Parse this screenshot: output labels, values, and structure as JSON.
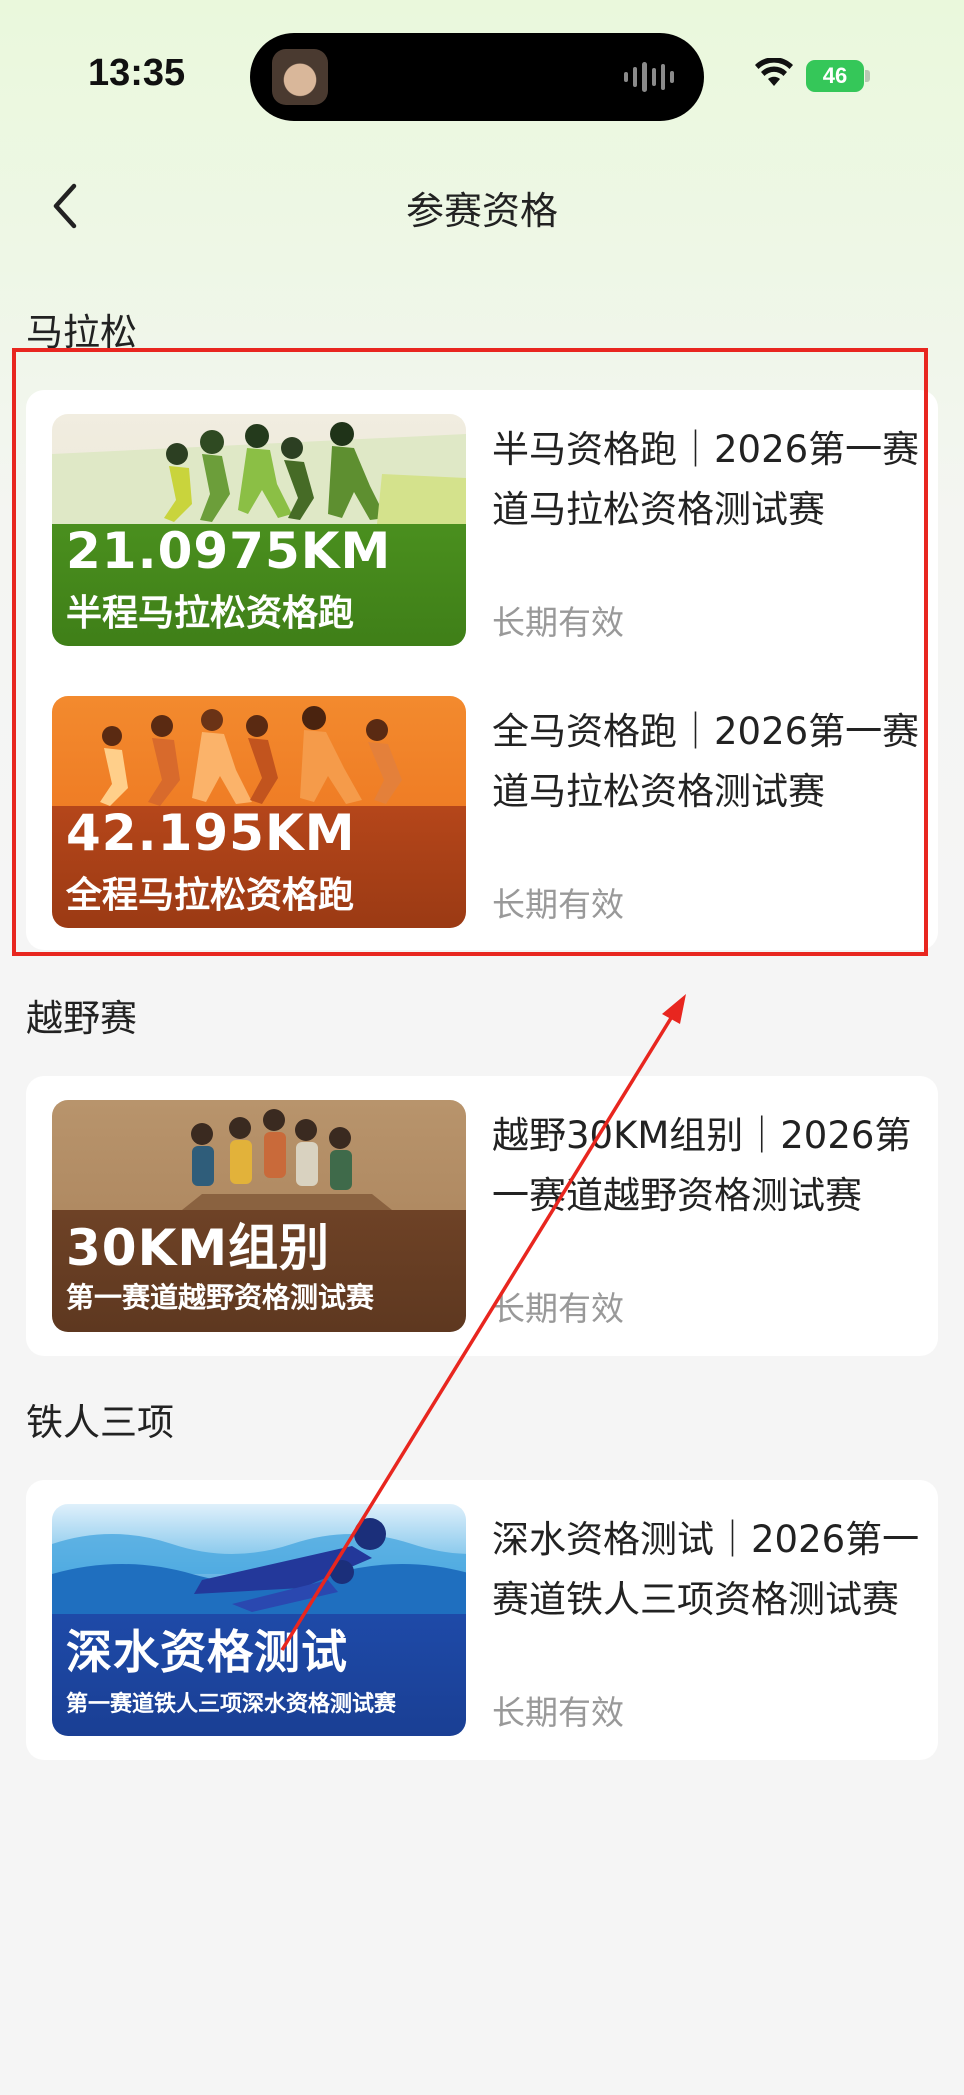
{
  "status_bar": {
    "time": "13:35",
    "battery": "46"
  },
  "header": {
    "title": "参赛资格"
  },
  "sections": [
    {
      "title": "马拉松",
      "items": [
        {
          "thumb_title": "21.0975KM",
          "thumb_subtitle": "半程马拉松资格跑",
          "name": "半马资格跑｜2026第一赛道马拉松资格测试赛",
          "status": "长期有效"
        },
        {
          "thumb_title": "42.195KM",
          "thumb_subtitle": "全程马拉松资格跑",
          "name": "全马资格跑｜2026第一赛道马拉松资格测试赛",
          "status": "长期有效"
        }
      ]
    },
    {
      "title": "越野赛",
      "items": [
        {
          "thumb_title": "30KM组别",
          "thumb_subtitle": "第一赛道越野资格测试赛",
          "name": "越野30KM组别｜2026第一赛道越野资格测试赛",
          "status": "长期有效"
        }
      ]
    },
    {
      "title": "铁人三项",
      "items": [
        {
          "thumb_title": "深水资格测试",
          "thumb_subtitle": "第一赛道铁人三项深水资格测试赛",
          "name": "深水资格测试｜2026第一赛道铁人三项资格测试赛",
          "status": "长期有效"
        }
      ]
    }
  ],
  "colors": {
    "accent_annotation": "#e8261f",
    "half_marathon": "#4a8f1e",
    "full_marathon": "#b5461a",
    "trail": "#6e4226",
    "triathlon": "#1e4aa8"
  }
}
